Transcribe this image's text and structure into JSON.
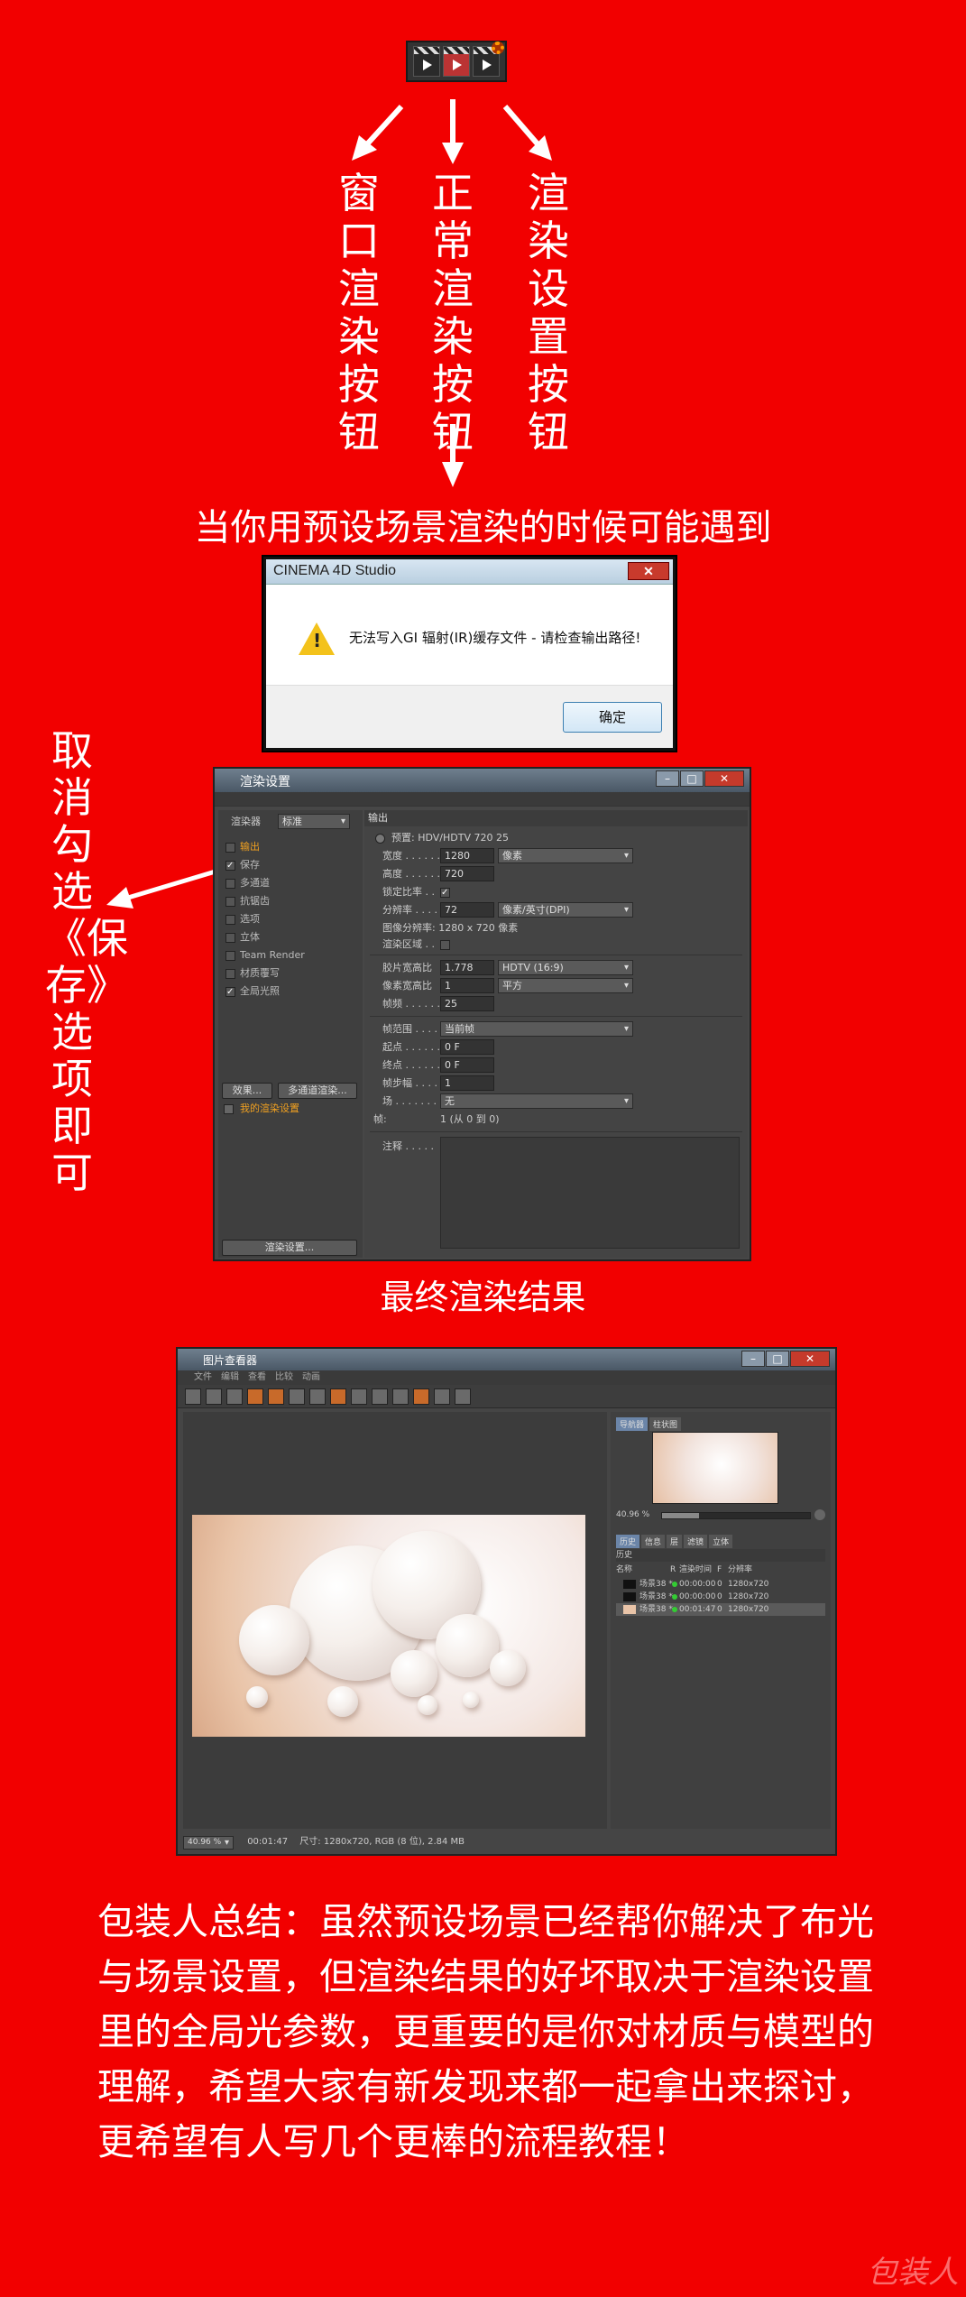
{
  "top_icons": {
    "window_render": "window-render-icon",
    "normal_render": "normal-render-icon",
    "render_settings": "render-settings-icon"
  },
  "vertical_labels": {
    "left": "窗口渲染按钮",
    "middle": "正常渲染按钮",
    "right": "渲染设置按钮"
  },
  "heading_1": "当你用预设场景渲染的时候可能遇到",
  "dialog": {
    "title": "CINEMA 4D Studio",
    "close": "✕",
    "message": "无法写入GI 辐射(IR)缓存文件 - 请检查输出路径!",
    "ok": "确定"
  },
  "side_note": "取消勾选《保存》选项即可",
  "render_settings": {
    "title": "渲染设置",
    "renderer_label": "渲染器",
    "renderer_value": "标准",
    "items": [
      {
        "label": "输出",
        "checked": "",
        "highlight": true
      },
      {
        "label": "保存",
        "checked": "✓",
        "highlight": false
      },
      {
        "label": "多通道",
        "checked": "",
        "highlight": false
      },
      {
        "label": "抗锯齿",
        "checked": "",
        "highlight": false
      },
      {
        "label": "选项",
        "checked": "",
        "highlight": false
      },
      {
        "label": "立体",
        "checked": "",
        "highlight": false
      },
      {
        "label": "Team Render",
        "checked": "",
        "highlight": false
      },
      {
        "label": "材质覆写",
        "checked": "",
        "highlight": false
      },
      {
        "label": "全局光照",
        "checked": "✓",
        "highlight": false
      }
    ],
    "effects_btn": "效果...",
    "multipass_btn": "多通道渲染...",
    "my_settings": "我的渲染设置",
    "bottom_btn": "渲染设置...",
    "section": "输出",
    "preset": "预置: HDV/HDTV 720 25",
    "width_label": "宽度 . . . . . .",
    "width": "1280",
    "width_unit": "像素",
    "height_label": "高度 . . . . . .",
    "height": "720",
    "lock_label": "锁定比率 . .",
    "lock": "✓",
    "res_label": "分辨率 . . . .",
    "res": "72",
    "res_unit": "像素/英寸(DPI)",
    "img_res": "图像分辨率:   1280 x 720 像素",
    "render_region": "渲染区域 . .",
    "film_label": "胶片宽高比",
    "film": "1.778",
    "film_value": "HDTV (16:9)",
    "pixel_label": "像素宽高比",
    "pixel": "1",
    "pixel_value": "平方",
    "fps_label": "帧频 . . . . . .",
    "fps": "25",
    "frame_range_label": "帧范围 . . . .",
    "frame_range": "当前帧",
    "start_label": "起点 . . . . . .",
    "start": "0 F",
    "end_label": "终点 . . . . . .",
    "end": "0 F",
    "step_label": "帧步幅 . . . .",
    "step": "1",
    "field_label": "场 . . . . . . . .",
    "field": "无",
    "frames_label": "帧:",
    "frames": "1 (从 0 到 0)",
    "notes_label": "注释 . . . . ."
  },
  "heading_2": "最终渲染结果",
  "picture_viewer": {
    "title": "图片查看器",
    "menu": [
      "文件",
      "编辑",
      "查看",
      "比较",
      "动画"
    ],
    "nav_tabs": [
      "导航器",
      "柱状图"
    ],
    "zoom": "40.96 %",
    "hist_tabs": [
      "历史",
      "信息",
      "层",
      "滤镜",
      "立体"
    ],
    "hist_title": "历史",
    "columns": [
      "名称",
      "R",
      "渲染时间",
      "F",
      "分辨率"
    ],
    "rows": [
      {
        "name": "场景38 *",
        "time": "00:00:00",
        "f": "0",
        "res": "1280x720"
      },
      {
        "name": "场景38 *",
        "time": "00:00:00",
        "f": "0",
        "res": "1280x720"
      },
      {
        "name": "场景38 *",
        "time": "00:01:47",
        "f": "0",
        "res": "1280x720"
      }
    ],
    "status_zoom": "40.96 %",
    "status_time": "00:01:47",
    "status_info": "尺寸: 1280x720, RGB (8 位), 2.84 MB"
  },
  "summary": "包装人总结：虽然预设场景已经帮你解决了布光与场景设置，但渲染结果的好坏取决于渲染设置 里的全局光参数，更重要的是你对材质与模型的理解，希望大家有新发现来都一起拿出来探讨，更希望有人写几个更棒的流程教程！",
  "watermark": "包装人",
  "colors": {
    "background": "#f20000",
    "highlight": "#f0a020",
    "warning": "#f3c21b"
  }
}
